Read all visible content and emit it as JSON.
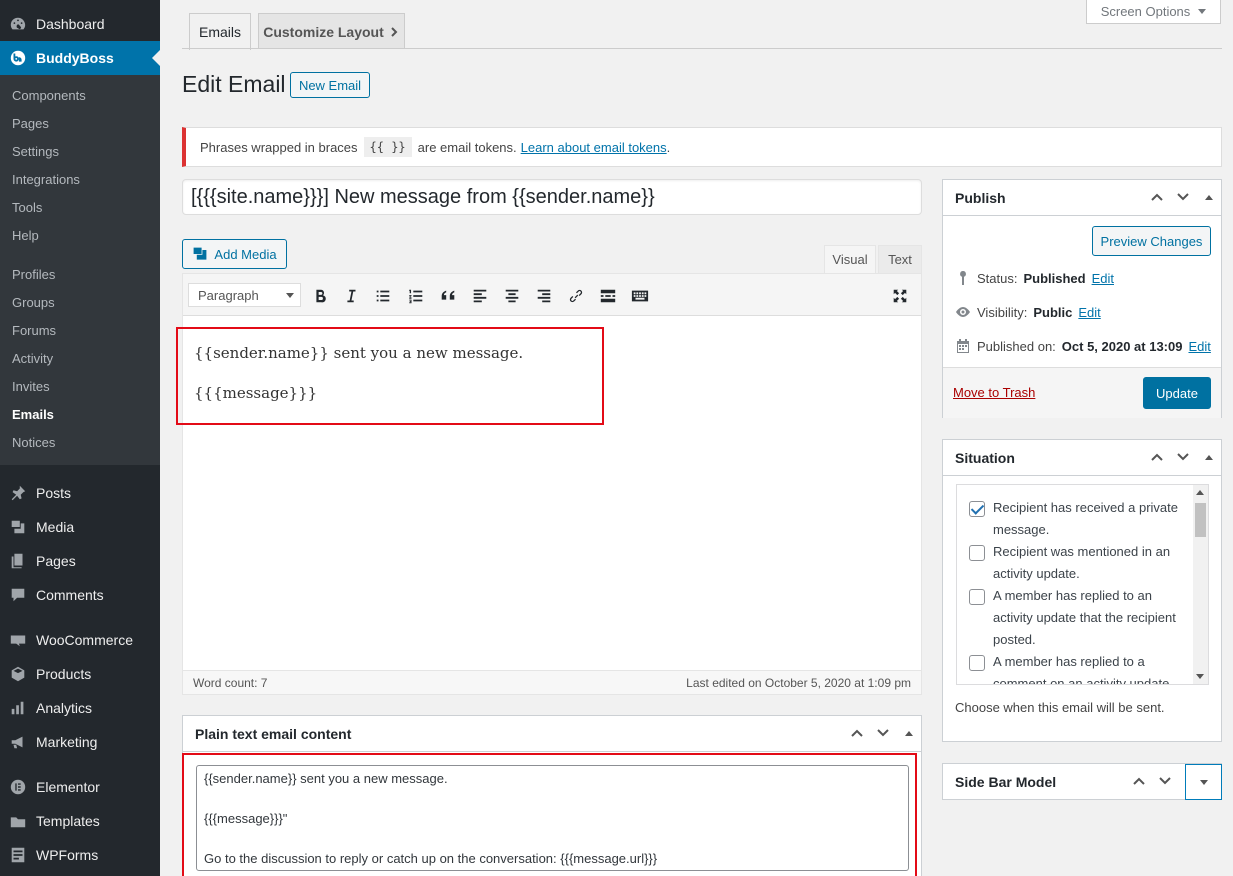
{
  "sidebar": {
    "items": [
      {
        "label": "Dashboard",
        "icon": "dashboard-icon"
      },
      {
        "label": "BuddyBoss",
        "icon": "buddyboss-icon"
      },
      {
        "label": "Posts",
        "icon": "pin-icon"
      },
      {
        "label": "Media",
        "icon": "media-icon"
      },
      {
        "label": "Pages",
        "icon": "pages-icon"
      },
      {
        "label": "Comments",
        "icon": "comments-icon"
      },
      {
        "label": "WooCommerce",
        "icon": "woocommerce-icon"
      },
      {
        "label": "Products",
        "icon": "products-icon"
      },
      {
        "label": "Analytics",
        "icon": "analytics-icon"
      },
      {
        "label": "Marketing",
        "icon": "marketing-icon"
      },
      {
        "label": "Elementor",
        "icon": "elementor-icon"
      },
      {
        "label": "Templates",
        "icon": "templates-icon"
      },
      {
        "label": "WPForms",
        "icon": "wpforms-icon"
      }
    ],
    "submenu": [
      "Components",
      "Pages",
      "Settings",
      "Integrations",
      "Tools",
      "Help",
      "Profiles",
      "Groups",
      "Forums",
      "Activity",
      "Invites",
      "Emails",
      "Notices"
    ]
  },
  "tabs": {
    "emails": "Emails",
    "customize": "Customize Layout"
  },
  "screen_options": "Screen Options",
  "page_title": "Edit Email",
  "new_email": "New Email",
  "notice": {
    "text_before": "Phrases wrapped in braces",
    "code": "{{ }}",
    "text_after": "are email tokens.",
    "link": "Learn about email tokens",
    "end": "."
  },
  "subject": "[{{{site.name}}}] New message from {{sender.name}}",
  "add_media": "Add Media",
  "editor_tabs": {
    "visual": "Visual",
    "text": "Text"
  },
  "format_select": "Paragraph",
  "content": {
    "line1": "{{sender.name}} sent you a new message.",
    "line2": "{{{message}}}"
  },
  "statusbar": {
    "word_count": "Word count: 7",
    "last_edited": "Last edited on October 5, 2020 at 1:09 pm"
  },
  "plain": {
    "title": "Plain text email content",
    "lines": [
      "{{sender.name}} sent you a new message.",
      "",
      "{{{message}}}\"",
      "",
      "Go to the discussion to reply or catch up on the conversation: {{{message.url}}}"
    ]
  },
  "publish": {
    "title": "Publish",
    "preview": "Preview Changes",
    "status_label": "Status:",
    "status_value": "Published",
    "visibility_label": "Visibility:",
    "visibility_value": "Public",
    "published_label": "Published on:",
    "published_value": "Oct 5, 2020 at 13:09",
    "edit": "Edit",
    "trash": "Move to Trash",
    "update": "Update"
  },
  "situation": {
    "title": "Situation",
    "items": [
      {
        "line1": "Recipient has received a private",
        "line2": "message.",
        "checked": true
      },
      {
        "line1": "Recipient was mentioned in an",
        "line2": "activity update.",
        "checked": false
      },
      {
        "line1": "A member has replied to an",
        "line2": "activity update that the recipient",
        "line3": "posted.",
        "checked": false
      },
      {
        "line1": "A member has replied to a",
        "line2": "comment on an activity update",
        "checked": false
      }
    ],
    "help": "Choose when this email will be sent."
  },
  "sidebar_model": {
    "title": "Side Bar Model"
  },
  "colors": {
    "accent": "#0073aa",
    "highlight": "#e30b17",
    "admin_bg": "#23282d"
  }
}
